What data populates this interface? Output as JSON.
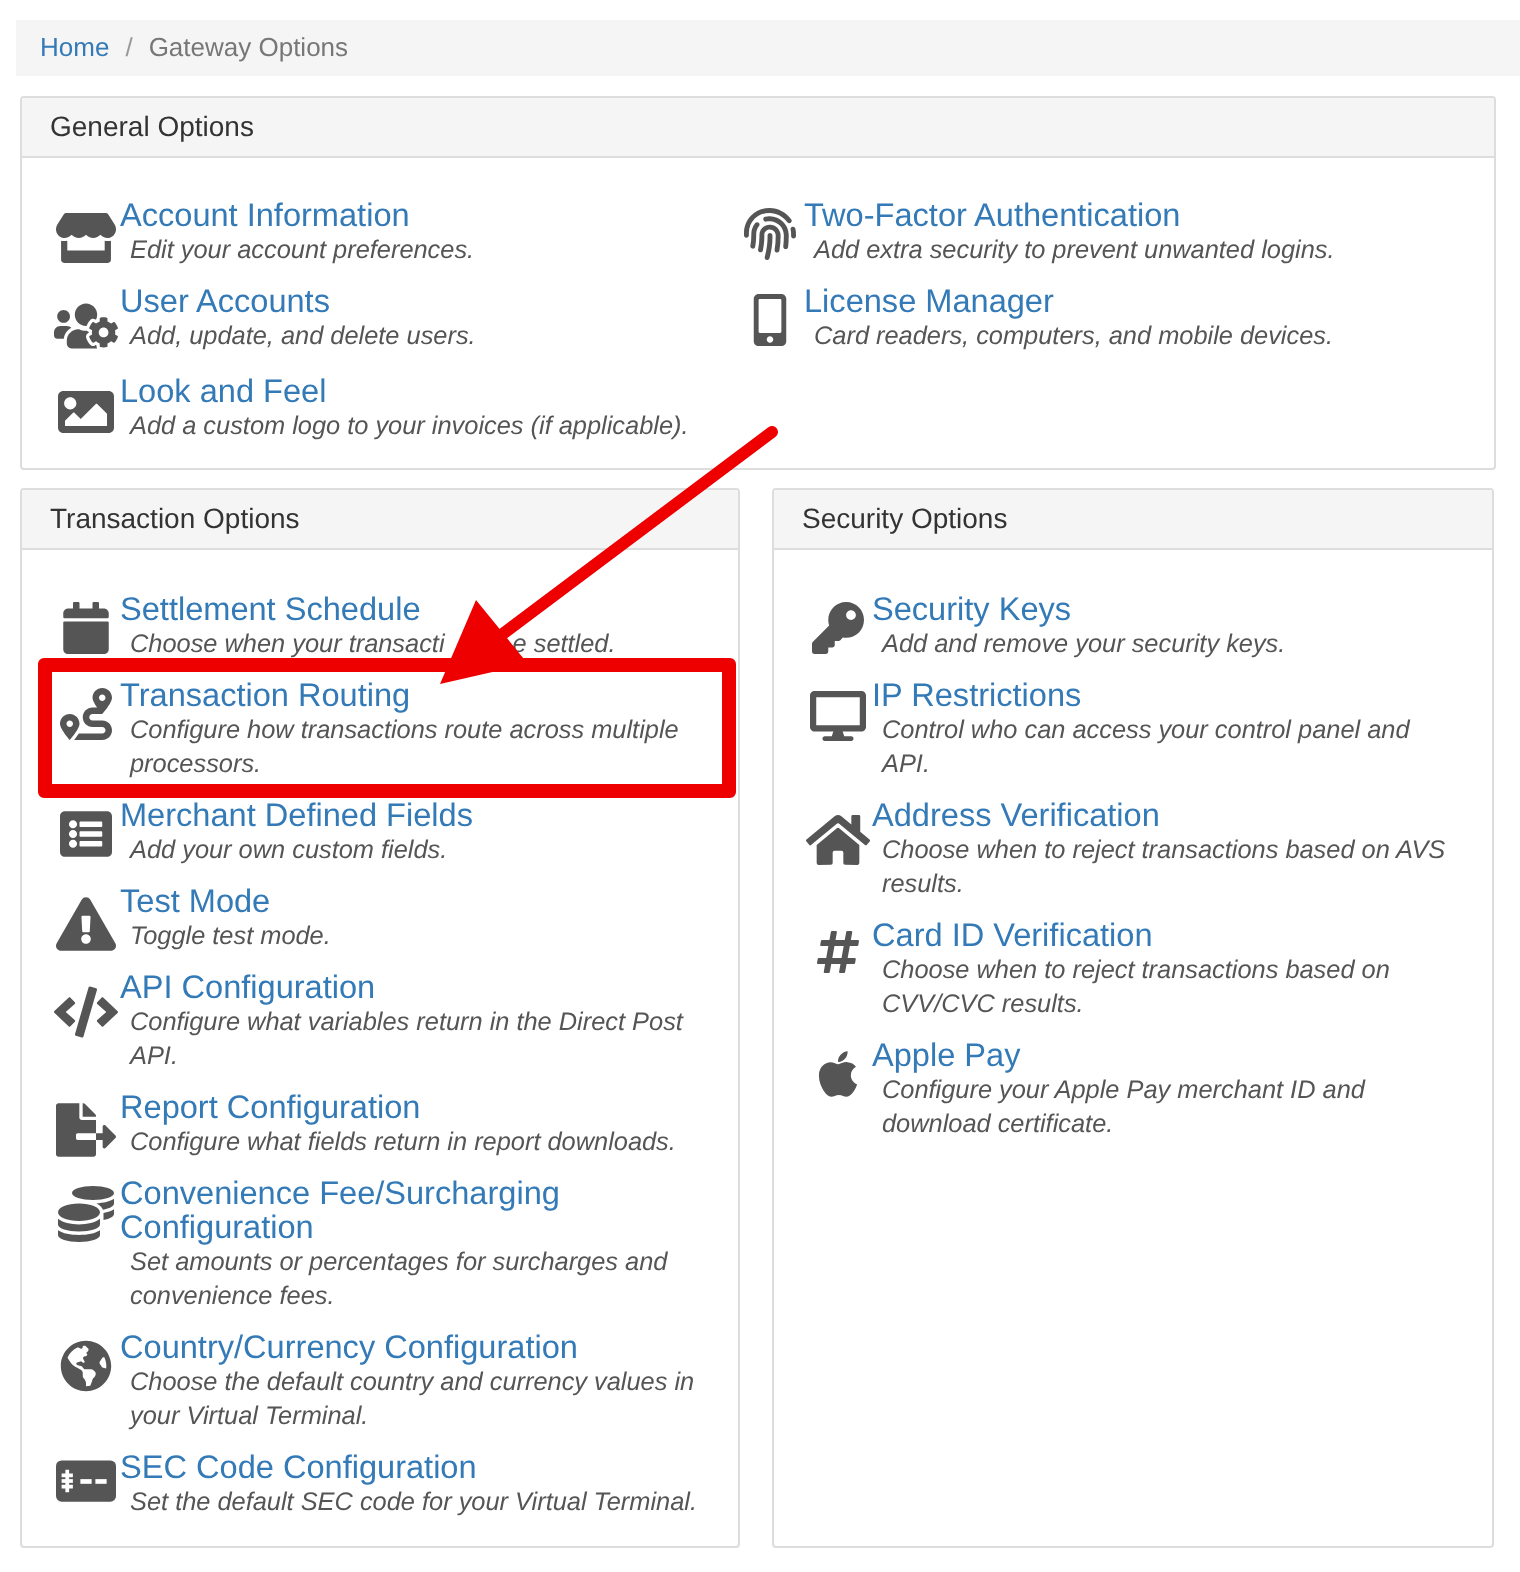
{
  "breadcrumb": {
    "separator": "/",
    "items": [
      {
        "label": "Home",
        "kind": "link"
      },
      {
        "label": "Gateway Options",
        "kind": "current"
      }
    ]
  },
  "general_options": {
    "title": "General Options",
    "columns": [
      [
        {
          "title": "Account Information",
          "description": [
            "Edit your account preferences."
          ],
          "highlighted": false
        },
        {
          "title": "User Accounts",
          "description": [
            "Add, update, and delete users."
          ],
          "highlighted": false
        },
        {
          "title": "Look and Feel",
          "description": [
            "Add a custom logo to your invoices (if applicable)."
          ],
          "highlighted": false
        }
      ],
      [
        {
          "title": "Two-Factor Authentication",
          "description": [
            "Add extra security to prevent unwanted logins."
          ],
          "highlighted": false
        },
        {
          "title": "License Manager",
          "description": [
            "Card readers, computers, and mobile devices."
          ],
          "highlighted": false
        }
      ]
    ]
  },
  "transaction_options": {
    "title": "Transaction Options",
    "items": [
      {
        "title": "Settlement Schedule",
        "description": [
          "Choose when your transacti",
          "e settled."
        ],
        "highlighted": false
      },
      {
        "title": "Transaction Routing",
        "description": [
          "Configure how transactions route across multiple processors."
        ],
        "highlighted": true
      },
      {
        "title": "Merchant Defined Fields",
        "description": [
          "Add your own custom fields."
        ],
        "highlighted": false
      },
      {
        "title": "Test Mode",
        "description": [
          "Toggle test mode."
        ],
        "highlighted": false
      },
      {
        "title": "API Configuration",
        "description": [
          "Configure what variables return in the Direct Post API."
        ],
        "highlighted": false
      },
      {
        "title": "Report Configuration",
        "description": [
          "Configure what fields return in report downloads."
        ],
        "highlighted": false
      },
      {
        "title": "Convenience Fee/Surcharging Configuration",
        "description": [
          "Set amounts or percentages for surcharges and convenience fees."
        ],
        "highlighted": false
      },
      {
        "title": "Country/Currency Configuration",
        "description": [
          "Choose the default country and currency values in your Virtual Terminal."
        ],
        "highlighted": false
      },
      {
        "title": "SEC Code Configuration",
        "description": [
          "Set the default SEC code for your Virtual Terminal."
        ],
        "highlighted": false
      }
    ]
  },
  "security_options": {
    "title": "Security Options",
    "items": [
      {
        "title": "Security Keys",
        "description": [
          "Add and remove your security keys."
        ],
        "highlighted": false
      },
      {
        "title": "IP Restrictions",
        "description": [
          "Control who can access your control panel and API."
        ],
        "highlighted": false
      },
      {
        "title": "Address Verification",
        "description": [
          "Choose when to reject transactions based on AVS results."
        ],
        "highlighted": false
      },
      {
        "title": "Card ID Verification",
        "description": [
          "Choose when to reject transactions based on CVV/CVC results."
        ],
        "highlighted": false
      },
      {
        "title": "Apple Pay",
        "description": [
          "Configure your Apple Pay merchant ID and download certificate."
        ],
        "highlighted": false
      }
    ]
  }
}
